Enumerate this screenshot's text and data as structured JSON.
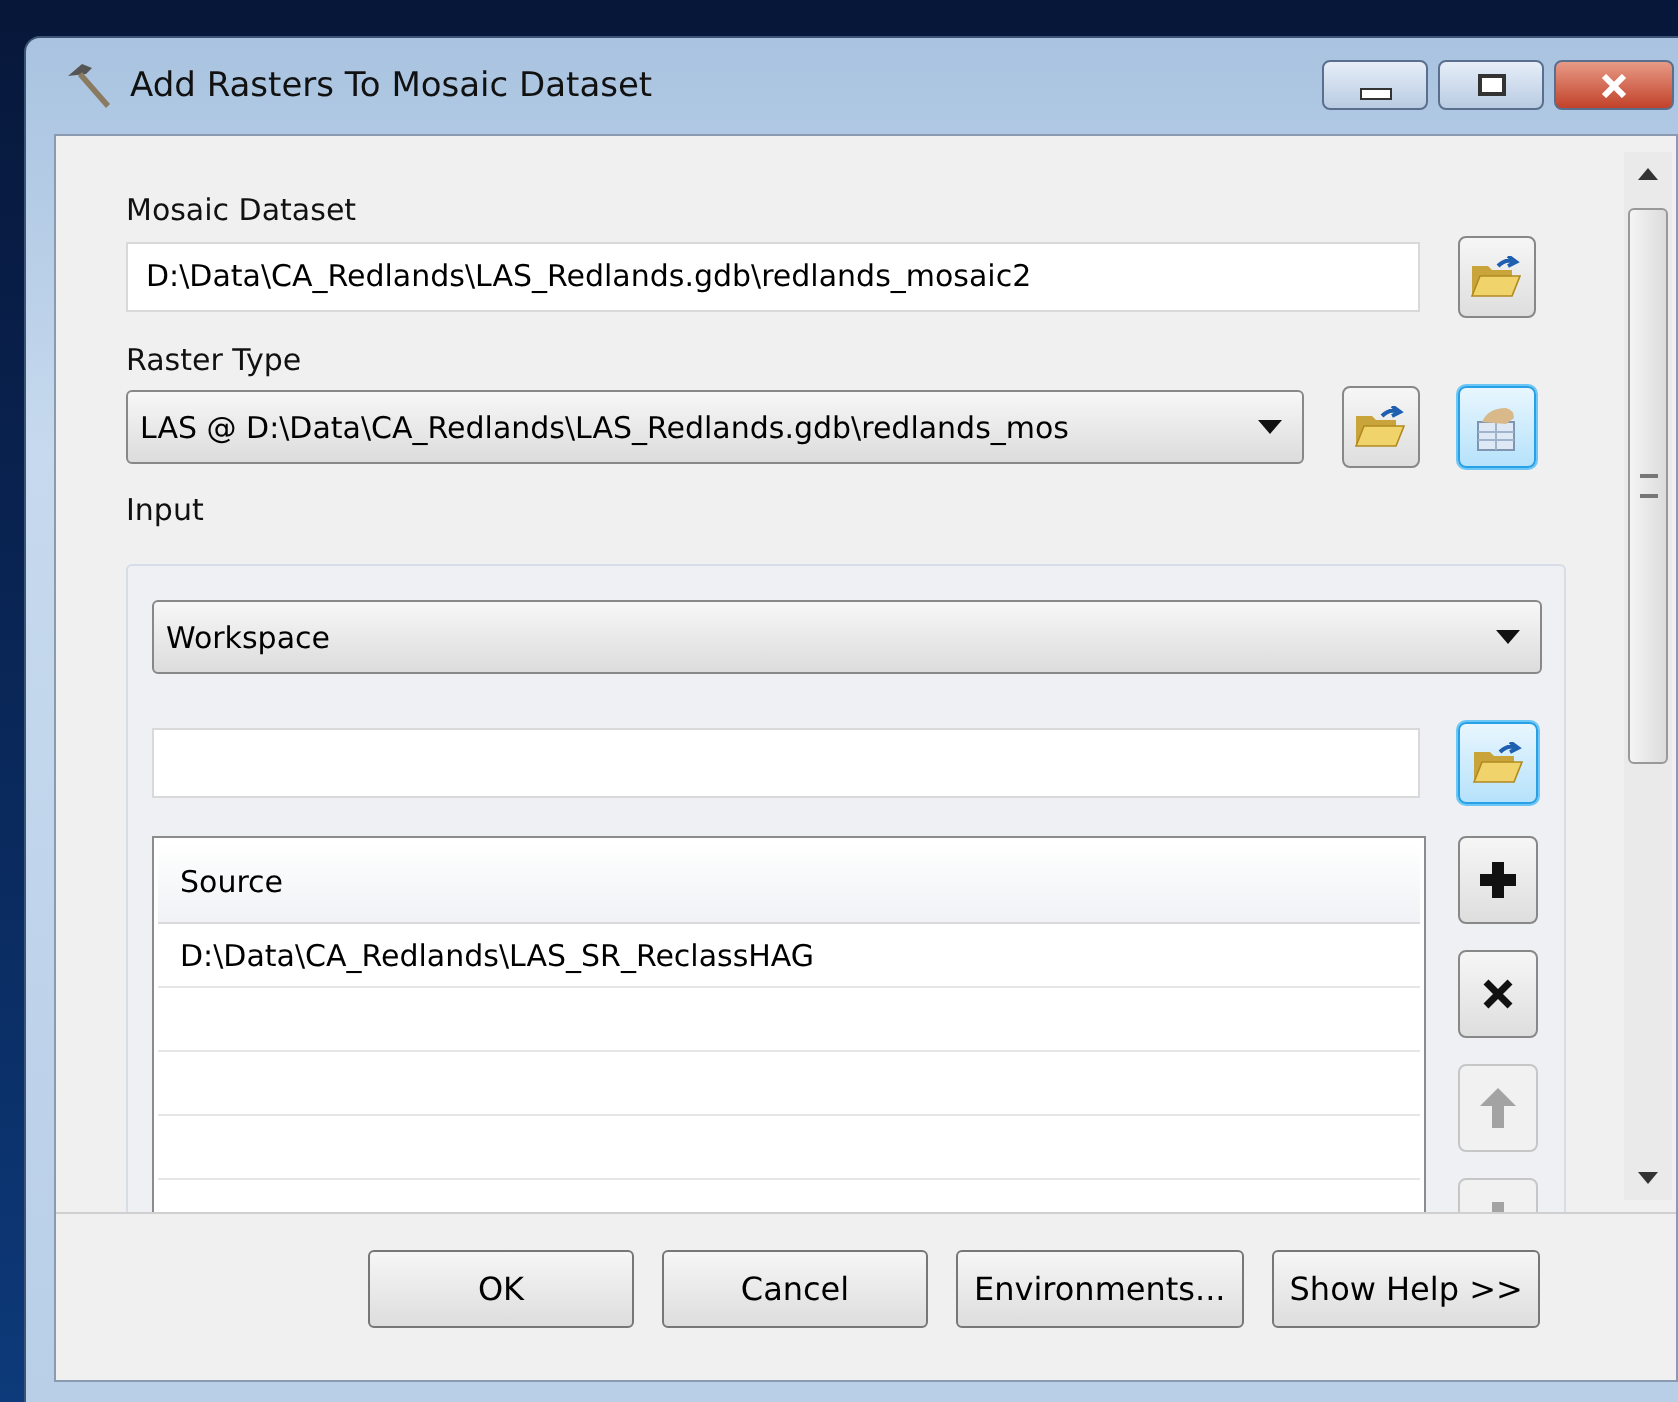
{
  "window": {
    "title": "Add Rasters To Mosaic Dataset"
  },
  "fields": [
    {
      "kind": "text",
      "label": "Mosaic Dataset",
      "value": "D:\\Data\\CA_Redlands\\LAS_Redlands.gdb\\redlands_mosaic2",
      "buttons": [
        {
          "kind": "folder",
          "highlighted": false
        }
      ]
    },
    {
      "kind": "dropdown",
      "label": "Raster Type",
      "value": "LAS @ D:\\Data\\CA_Redlands\\LAS_Redlands.gdb\\redlands_mos",
      "buttons": [
        {
          "kind": "folder",
          "highlighted": false
        },
        {
          "kind": "properties",
          "highlighted": true
        }
      ]
    }
  ],
  "input": {
    "label": "Input",
    "type": "Workspace",
    "path_button": {
      "kind": "folder",
      "highlighted": true
    },
    "table": {
      "columns": [
        "Source"
      ],
      "rows": [
        "D:\\Data\\CA_Redlands\\LAS_SR_ReclassHAG"
      ]
    },
    "side_buttons": [
      {
        "kind": "add",
        "disabled": false
      },
      {
        "kind": "remove",
        "disabled": false
      },
      {
        "kind": "up",
        "disabled": true
      },
      {
        "kind": "down",
        "disabled": true
      }
    ]
  },
  "buttons": [
    "OK",
    "Cancel",
    "Environments...",
    "Show Help >>"
  ]
}
